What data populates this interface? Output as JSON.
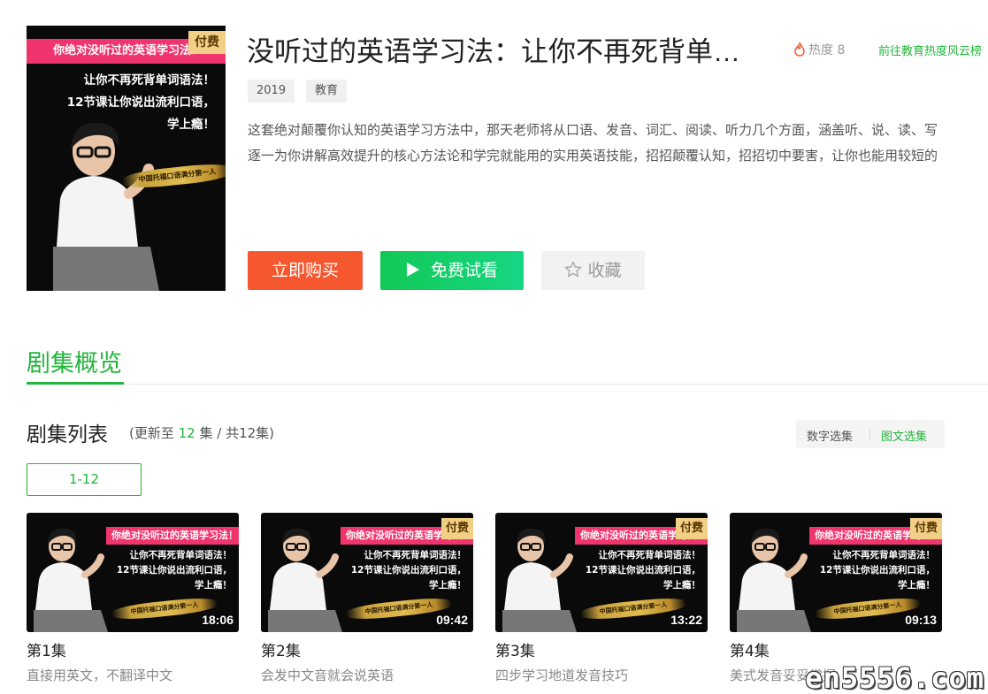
{
  "course": {
    "title": "没听过的英语学习法：让你不再死背单…",
    "heat_label": "热度 8",
    "heat_link": "前往教育热度风云榜",
    "tags": [
      "2019",
      "教育"
    ],
    "description_lines": [
      "这套绝对颠覆你认知的英语学习方法中，那天老师将从口语、发音、词汇、阅读、听力几个方面，涵盖听、说、读、写",
      "逐一为你讲解高效提升的核心方法论和学完就能用的实用英语技能，招招颠覆认知，招招切中要害，让你也能用较短的"
    ],
    "buy_label": "立即购买",
    "free_label": "免费试看",
    "fav_label": "收藏"
  },
  "poster": {
    "banner": "你绝对没听过的英语学习法！",
    "line1": "让你不再死背单词语法！",
    "line2": "12节课让你说出流利口语，",
    "line3": "学上瘾！",
    "brush": "中国托福口语满分第一人",
    "paid_badge": "付费"
  },
  "section": {
    "title": "剧集概览",
    "list_title": "剧集列表",
    "meta_prefix": "(更新至 ",
    "meta_count": "12",
    "meta_suffix": " 集 / 共12集)",
    "mode_number": "数字选集",
    "mode_image": "图文选集",
    "range": "1-12"
  },
  "episodes": [
    {
      "title": "第1集",
      "subtitle": "直接用英文，不翻译中文",
      "duration": "18:06",
      "paid": false
    },
    {
      "title": "第2集",
      "subtitle": "会发中文音就会说英语",
      "duration": "09:42",
      "paid": true
    },
    {
      "title": "第3集",
      "subtitle": "四步学习地道发音技巧",
      "duration": "13:22",
      "paid": true
    },
    {
      "title": "第4集",
      "subtitle": "美式发音妥妥掌握",
      "duration": "09:13",
      "paid": true
    }
  ],
  "watermark": "en5556.com",
  "colors": {
    "accent_green": "#22b53b",
    "buy_orange": "#f5582f",
    "banner_pink": "#f0356e",
    "paid_gold": "#f1cf86"
  }
}
